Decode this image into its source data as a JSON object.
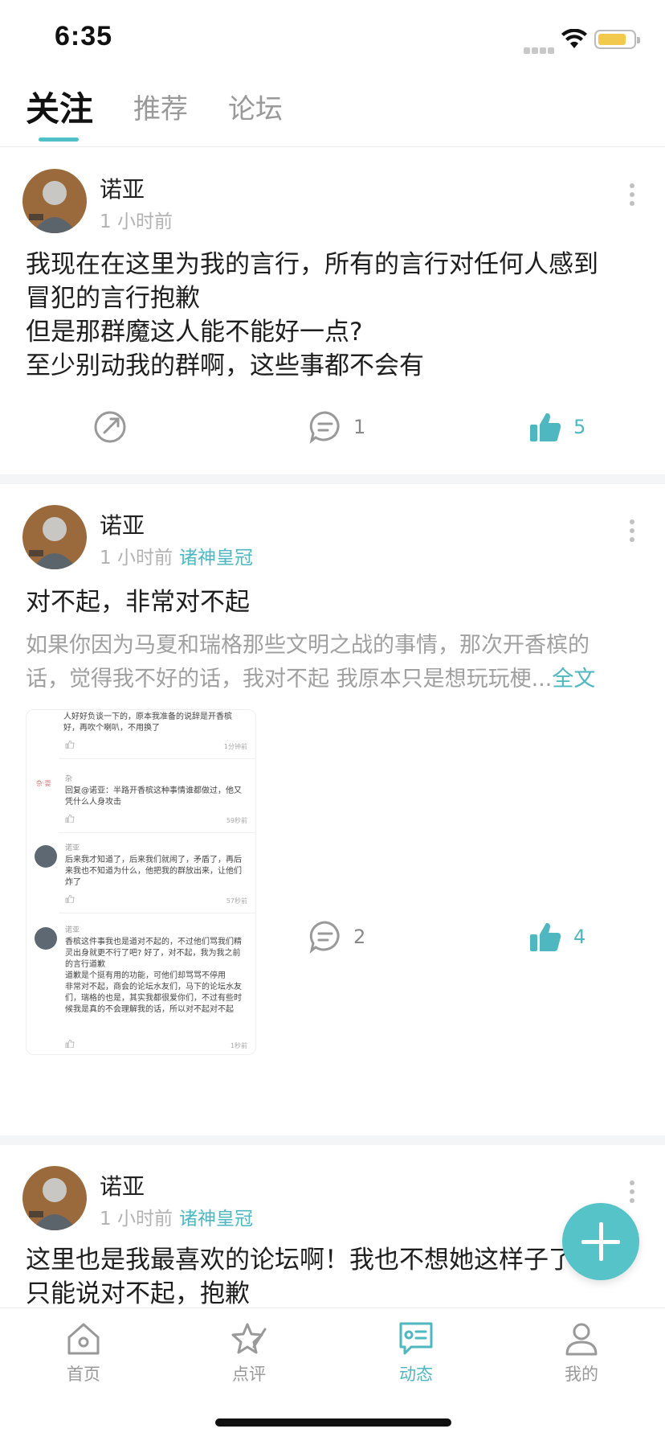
{
  "status_bar": {
    "time": "6:35"
  },
  "tabs": [
    {
      "label": "关注",
      "active": true
    },
    {
      "label": "推荐",
      "active": false
    },
    {
      "label": "论坛",
      "active": false
    }
  ],
  "posts": [
    {
      "author": "诺亚",
      "time": "1 小时前",
      "forum": "",
      "lines": [
        "我现在在这里为我的言行，所有的言行对任何人感到",
        "冒犯的言行抱歉",
        "但是那群魔这人能不能好一点?",
        "至少别动我的群啊，这些事都不会有"
      ],
      "comments": "1",
      "likes": "5"
    },
    {
      "author": "诺亚",
      "time": "1 小时前",
      "forum": "诸神皇冠",
      "title": "对不起，非常对不起",
      "summary_lines": [
        "如果你因为马夏和瑞格那些文明之战的事情，那次开香槟的",
        "话，觉得我不好的话，我对不起 我原本只是想玩玩梗..."
      ],
      "full_text_link": "全文",
      "embedded_image": {
        "top_text": [
          "人好好负谈一下的，原本我准备的说辞是开香槟",
          "好，再吹个喇叭，不用换了"
        ],
        "top_time": "1分钟前",
        "comment1_name": "杂",
        "comment1_avatar_text": "杂·耍",
        "comment1_lines": [
          "回复@诺亚：半路开香槟这种事情谁都做过，他又",
          "凭什么人身攻击"
        ],
        "comment1_time": "59秒前",
        "comment2_name": "诺亚",
        "comment2_lines": [
          "后来我才知道了，后来我们就闹了，矛盾了，再后",
          "来我也不知道为什么，他把我的群放出来，让他们",
          "炸了"
        ],
        "comment2_time": "57秒前",
        "comment3_name": "诺亚",
        "comment3_lines": [
          "香槟这件事我也是道对不起的，不过他们骂我们精",
          "灵出身就更不行了吧? 好了，对不起，我为我之前",
          "的言行道歉",
          "道歉是个挺有用的功能，可他们却骂骂不停用",
          "非常对不起，商会的论坛水友们，马下的论坛水友",
          "们，瑞格的也是，其实我都很爱你们，不过有些时",
          "候我是真的不会理解我的话，所以对不起对不起"
        ],
        "comment3_time": "1秒前"
      },
      "comments": "2",
      "likes": "4"
    },
    {
      "author": "诺亚",
      "time": "1 小时前",
      "forum": "诸神皇冠",
      "lines": [
        "这里也是我最喜欢的论坛啊！我也不想她这样子了，我",
        "只能说对不起，抱歉"
      ]
    }
  ],
  "bottom_nav": [
    {
      "label": "首页",
      "icon": "home-icon",
      "active": false
    },
    {
      "label": "点评",
      "icon": "star-pen-icon",
      "active": false
    },
    {
      "label": "动态",
      "icon": "message-card-icon",
      "active": true
    },
    {
      "label": "我的",
      "icon": "person-icon",
      "active": false
    }
  ],
  "colors": {
    "accent": "#4fb7c0",
    "fab": "#55c3c8",
    "separator": "#f3f5f6"
  }
}
